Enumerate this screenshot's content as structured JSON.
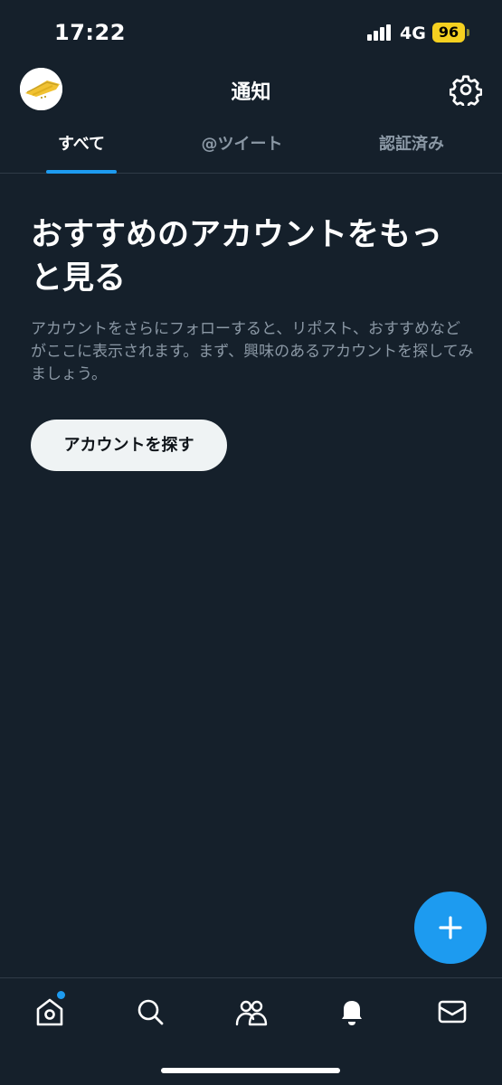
{
  "status_bar": {
    "time": "17:22",
    "network": "4G",
    "battery": "96",
    "battery_color": "#f5d020"
  },
  "header": {
    "title": "通知",
    "avatar_icon": "user-avatar",
    "settings_icon": "gear-icon"
  },
  "tabs": [
    {
      "label": "すべて",
      "active": true
    },
    {
      "label": "@ツイート",
      "active": false
    },
    {
      "label": "認証済み",
      "active": false
    }
  ],
  "main": {
    "heading_line1": "おすすめのアカウントをもっ",
    "heading_line2": "と見る",
    "description": "アカウントをさらにフォローすると、リポスト、おすすめなどがここに表示されます。まず、興味のあるアカウントを探してみましょう。",
    "button_label": "アカウントを探す"
  },
  "fab": {
    "icon": "plus-icon"
  },
  "bottom_nav": [
    {
      "icon": "home-icon",
      "has_badge": true
    },
    {
      "icon": "search-icon"
    },
    {
      "icon": "communities-icon"
    },
    {
      "icon": "bell-icon",
      "active": true
    },
    {
      "icon": "mail-icon"
    }
  ],
  "colors": {
    "background": "#15202b",
    "accent": "#1d9bf0",
    "muted_text": "#8b98a5",
    "divider": "#2f3b47"
  }
}
